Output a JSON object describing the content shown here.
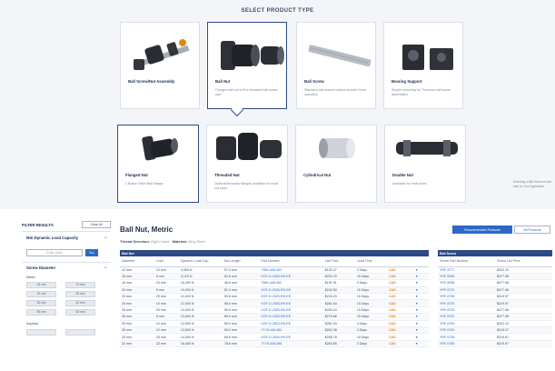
{
  "header": {
    "title": "SELECT PRODUCT TYPE"
  },
  "product_types": [
    {
      "title": "Ball Screw/Nut Assembly",
      "desc": ""
    },
    {
      "title": "Ball Nut",
      "desc": "Flanged ball nut to fit a threaded ball screw part"
    },
    {
      "title": "Ball Screw",
      "desc": "Standard ball screws feature smooth linear operation"
    },
    {
      "title": "Bearing Support",
      "desc": "Simple mounting for Thomson ball screw assemblies"
    }
  ],
  "nut_types": [
    {
      "title": "Flanged Nut",
      "desc": "1 Button Steel Ball Swage"
    },
    {
      "title": "Threaded Nut",
      "desc": "Optional threaded flanges available for most nut sizes"
    },
    {
      "title": "Cylindrical Nut",
      "desc": ""
    },
    {
      "title": "Double Nut",
      "desc": "Available for most sizes"
    }
  ],
  "side_note": "Selecting a Ball Screw should help for Your Application",
  "filters": {
    "title": "FILTER RESULTS",
    "clear_label": "Clear All",
    "capacity": {
      "title": "Min Dynamic Load Capacity",
      "toggle": "−",
      "placeholder": "Enter value",
      "go": "N  ▸"
    },
    "diameter": {
      "title": "Screw Diameter",
      "toggle": "−",
      "label": "Metric",
      "chips": [
        "16 mm",
        "12 mm",
        "20 mm",
        "25 mm",
        "32 mm",
        "40 mm",
        "50 mm",
        "63 mm"
      ]
    },
    "imperial_label": "Imperial"
  },
  "main": {
    "title": "Ball Nut, Metric",
    "meta_label": "Thread Direction:",
    "meta_value": "Right Hand",
    "meta_label2": "Material:",
    "meta_value2": "Alloy Steel",
    "btn_recommended": "Recommended Products",
    "btn_all": "All Products"
  },
  "table": {
    "band": "Ball Nut",
    "headers": [
      "Diameter",
      "Lead",
      "Dynamic Load Cap.",
      "Nut Length",
      "Part Number",
      "List Price",
      "Lead Time",
      "",
      ""
    ],
    "rows": [
      [
        "12 mm",
        "10 mm",
        "4,500 N",
        "57.0 mm",
        "7065-448-002",
        "$193.27",
        "3 Days",
        "CAD",
        "♥"
      ],
      [
        "16 mm",
        "5 mm",
        "9,120 N",
        "52.6 mm",
        "KGF-D-1605-RH-EE",
        "$204.76",
        "15 Days",
        "CAD",
        "♥"
      ],
      [
        "16 mm",
        "10 mm",
        "10,400 N",
        "48.0 mm",
        "7065-448-002",
        "$191.91",
        "3 Days",
        "CAD",
        "♥"
      ],
      [
        "20 mm",
        "5 mm",
        "10,900 N",
        "51.0 mm",
        "KGF-D-2005-RH-EE",
        "$242.60",
        "15 Days",
        "CAD",
        "♥"
      ],
      [
        "20 mm",
        "20 mm",
        "11,400 N",
        "59.6 mm",
        "KGF-D-2020-RH-EE",
        "$224.20",
        "15 Days",
        "CAD",
        "♥"
      ],
      [
        "25 mm",
        "10 mm",
        "12,500 N",
        "58.0 mm",
        "KGF-D-2505-RH-EE",
        "$281.64",
        "15 Days",
        "CAD",
        "♥"
      ],
      [
        "25 mm",
        "25 mm",
        "13,000 N",
        "56.0 mm",
        "KGF-D-2525-RH-EE",
        "$253.04",
        "15 Days",
        "CAD",
        "♥"
      ],
      [
        "25 mm",
        "5 mm",
        "13,500 N",
        "69.0 mm",
        "KGF-D-2505-RH-EE",
        "$276.88",
        "15 Days",
        "CAD",
        "♥"
      ],
      [
        "25 mm",
        "10 mm",
        "13,500 N",
        "58.0 mm",
        "KGF-D-2510-RH-EE",
        "$261.54",
        "3 Days",
        "CAD",
        "♥"
      ],
      [
        "25 mm",
        "10 mm",
        "13,500 N",
        "58.0 mm",
        "7Y78-448-084",
        "$262.08",
        "3 Days",
        "CAD",
        "♥"
      ],
      [
        "25 mm",
        "25 mm",
        "14,000 N",
        "69.6 mm",
        "KGF-D-2525-RH-EE",
        "$258.78",
        "15 Days",
        "CAD",
        "♥"
      ],
      [
        "32 mm",
        "32 mm",
        "16,400 N",
        "78.6 mm",
        "7Y78-448-086",
        "$263.65",
        "3 Days",
        "CAD",
        "♥"
      ]
    ]
  },
  "right_table": {
    "band": "Ball Screw",
    "headers": [
      "Screw Part Number",
      "Screw List Price"
    ],
    "rows": [
      [
        "YRF-3777",
        "$342.10"
      ],
      [
        "YRF-5598",
        "$477.98"
      ],
      [
        "YRF-5598",
        "$477.98"
      ],
      [
        "YRF-5722",
        "$477.98"
      ],
      [
        "YRF-5796",
        "$319.97"
      ],
      [
        "YRF-5725",
        "$319.97"
      ],
      [
        "YRF-5703",
        "$477.98"
      ],
      [
        "YRF-5702",
        "$477.98"
      ],
      [
        "YRF-5703",
        "$422.10"
      ],
      [
        "YRF-5763",
        "$319.97"
      ],
      [
        "YRF-5736",
        "$319.97"
      ],
      [
        "YRF-5765",
        "$319.97"
      ]
    ]
  }
}
